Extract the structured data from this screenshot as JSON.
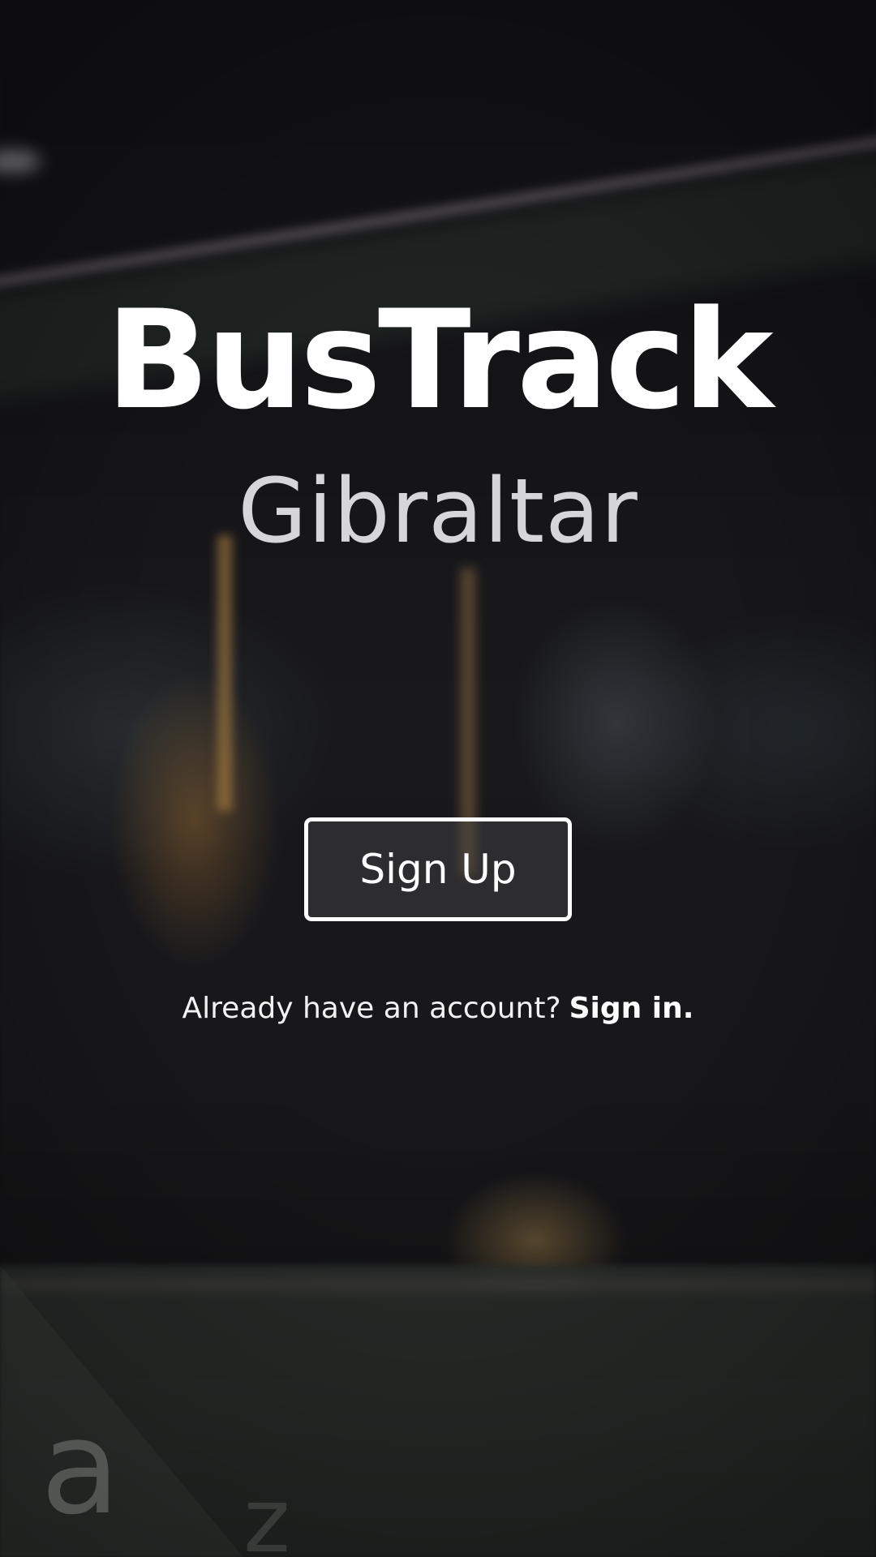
{
  "app": {
    "title": "BusTrack",
    "subtitle": "Gibraltar"
  },
  "actions": {
    "signup_label": "Sign Up",
    "signin_prompt": "Already have an account?",
    "signin_link": "Sign in."
  },
  "background": {
    "description_glyphs": [
      "a",
      "z"
    ]
  },
  "colors": {
    "text_primary": "#ffffff",
    "text_secondary": "#d6d6d8",
    "background": "#141417"
  }
}
